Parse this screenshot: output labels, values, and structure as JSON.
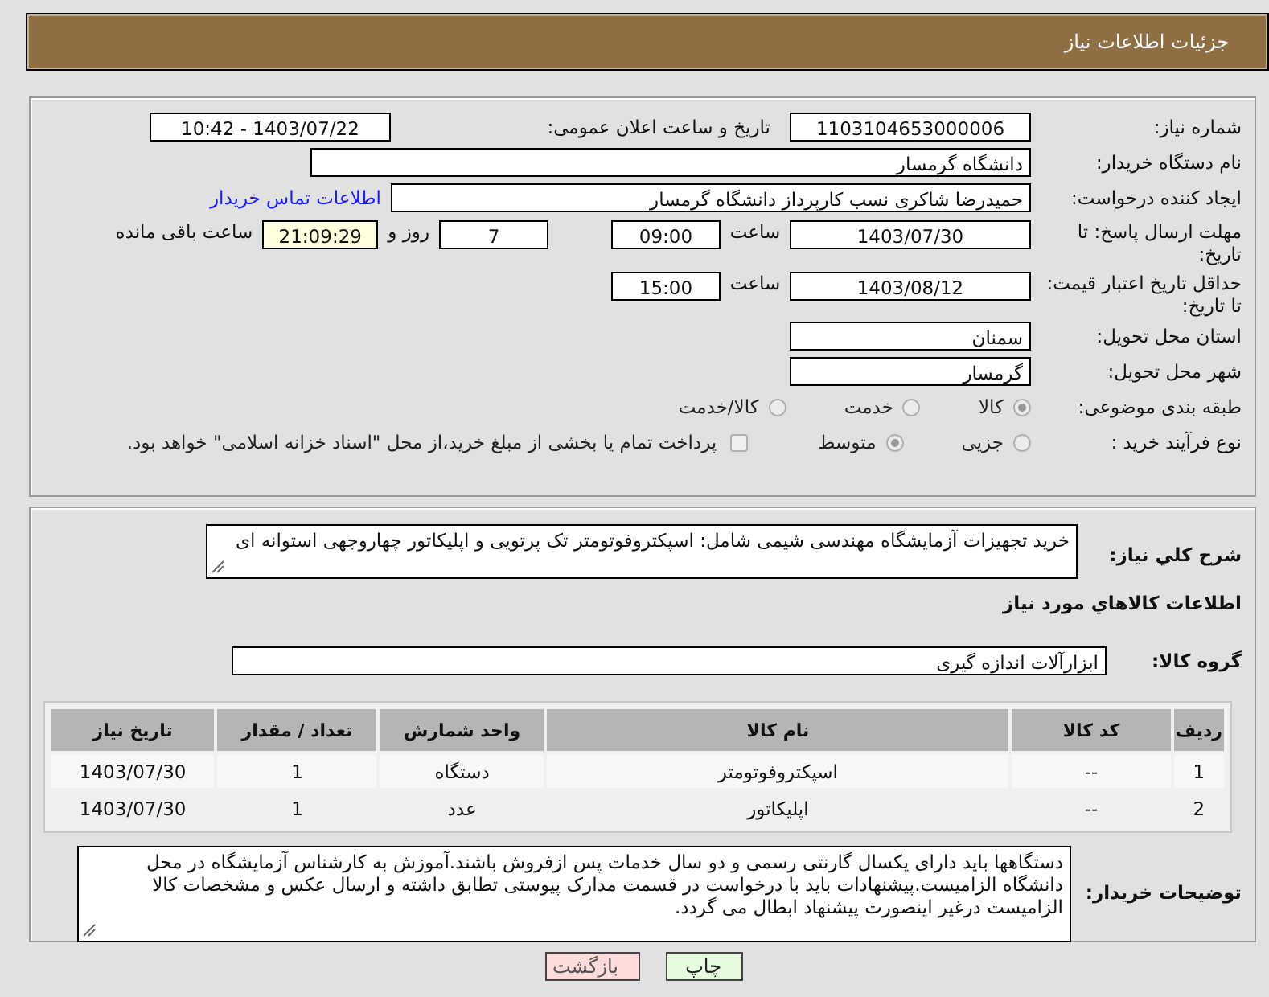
{
  "header": {
    "title": "جزئیات اطلاعات نیاز"
  },
  "need_number": {
    "label": "شماره نیاز:",
    "value": "1103104653000006"
  },
  "announce": {
    "label": "تاریخ و ساعت اعلان عمومی:",
    "value": "1403/07/22 - 10:42"
  },
  "buyer_org": {
    "label": "نام دستگاه خریدار:",
    "value": "دانشگاه گرمسار"
  },
  "requester": {
    "label": "ایجاد کننده درخواست:",
    "value": "حمیدرضا شاکری نسب کارپرداز دانشگاه گرمسار",
    "link": "اطلاعات تماس خریدار"
  },
  "reply_deadline": {
    "label": "مهلت ارسال پاسخ: تا تاریخ:",
    "date": "1403/07/30",
    "time_label": "ساعت",
    "time": "09:00",
    "days": "7",
    "days_label": "روز و",
    "remaining": "21:09:29",
    "remaining_label": "ساعت باقی مانده"
  },
  "price_validity": {
    "label": "حداقل تاریخ اعتبار قیمت: تا تاریخ:",
    "date": "1403/08/12",
    "time_label": "ساعت",
    "time": "15:00"
  },
  "province": {
    "label": "استان محل تحویل:",
    "value": "سمنان"
  },
  "city": {
    "label": "شهر محل تحویل:",
    "value": "گرمسار"
  },
  "category": {
    "label": "طبقه بندی موضوعی:",
    "options": [
      {
        "label": "کالا",
        "selected": true
      },
      {
        "label": "خدمت",
        "selected": false
      },
      {
        "label": "کالا/خدمت",
        "selected": false
      }
    ]
  },
  "process": {
    "label": "نوع فرآیند خرید :",
    "options": [
      {
        "label": "جزیی",
        "selected": false
      },
      {
        "label": "متوسط",
        "selected": true
      }
    ],
    "payment": {
      "checked": false,
      "text": "پرداخت تمام یا بخشی از مبلغ خرید،از محل \"اسناد خزانه اسلامی\" خواهد بود."
    }
  },
  "description": {
    "label": "شرح كلي نياز:",
    "value": "خرید تجهیزات آزمایشگاه مهندسی شیمی شامل: اسپکتروفوتومتر تک پرتویی و اپلیکاتور چهاروجهی استوانه ای"
  },
  "items_heading": "اطلاعات كالاهاي مورد نياز",
  "goods_group": {
    "label": "گروه کالا:",
    "value": "ابزارآلات اندازه گیری"
  },
  "table": {
    "columns": [
      "ردیف",
      "کد کالا",
      "نام کالا",
      "واحد شمارش",
      "تعداد / مقدار",
      "تاریخ نیاز"
    ],
    "rows": [
      [
        "1",
        "--",
        "اسپکتروفوتومتر",
        "دستگاه",
        "1",
        "1403/07/30"
      ],
      [
        "2",
        "--",
        "اپلیکاتور",
        "عدد",
        "1",
        "1403/07/30"
      ]
    ]
  },
  "buyer_notes": {
    "label": "توضیحات خریدار:",
    "value": "دستگاهها باید دارای یکسال گارنتی رسمی و دو سال خدمات پس ازفروش باشند.آموزش به کارشناس آزمایشگاه در محل دانشگاه الزامیست.پیشنهادات باید با درخواست در قسمت مدارک پیوستی تطابق داشته و ارسال عکس و مشخصات کالا الزامیست درغیر اینصورت پیشنهاد ابطال می گردد."
  },
  "buttons": [
    {
      "label": "چاپ",
      "kind": "print"
    },
    {
      "label": "بازگشت",
      "kind": "back"
    }
  ]
}
